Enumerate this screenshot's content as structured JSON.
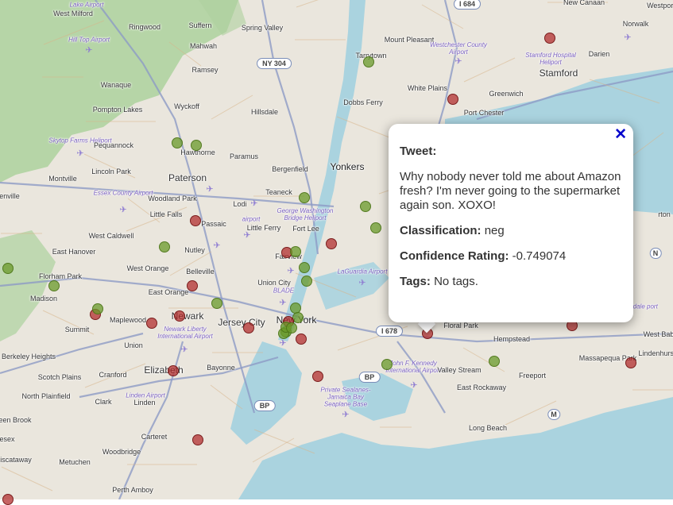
{
  "map": {
    "labels": {
      "west_milford": "West Milford",
      "greenwood_lake_airport": "Lake Airport",
      "ringwood": "Ringwood",
      "suffern": "Suffern",
      "spring_valley": "Spring Valley",
      "new_canaan": "New Canaan",
      "westport": "Westport",
      "hill_top_airport": "Hill Top Airport",
      "mahwah": "Mahwah",
      "mount_pleasant": "Mount Pleasant",
      "westchester_airport": "Westchester County Airport",
      "norwalk": "Norwalk",
      "darien": "Darien",
      "ramsey": "Ramsey",
      "tarrytown": "Tarrytown",
      "stamford_hospital": "Stamford Hospital Heliport",
      "stamford": "Stamford",
      "wanaque": "Wanaque",
      "white_plains": "White Plains",
      "greenwich": "Greenwich",
      "pompton_lakes": "Pompton Lakes",
      "wyckoff": "Wyckoff",
      "hillsdale": "Hillsdale",
      "dobbs_ferry": "Dobbs Ferry",
      "port_chester": "Port Chester",
      "skytop_heliport": "Skytop Farms Heliport",
      "pequannock": "Pequannock",
      "hawthorne": "Hawthorne",
      "paramus": "Paramus",
      "paterson": "Paterson",
      "montville": "Montville",
      "lincoln_park": "Lincoln Park",
      "bergenfield": "Bergenfield",
      "yonkers": "Yonkers",
      "essex_airport": "Essex County Airport",
      "woodland_park": "Woodland Park",
      "teaneck": "Teaneck",
      "genville": "enville",
      "little_falls": "Little Falls",
      "lodi": "Lodi",
      "gw_bridge_heliport": "George Washington Bridge Heliport",
      "airport_teterboro": "airport",
      "passaic": "Passaic",
      "little_ferry": "Little Ferry",
      "fort_lee": "Fort Lee",
      "west_caldwell": "West Caldwell",
      "east_hanover": "East Hanover",
      "nutley": "Nutley",
      "fairview": "Fairview",
      "west_orange": "West Orange",
      "belleville": "Belleville",
      "florham_park": "Florham Park",
      "union_city": "Union City",
      "laguardia": "LaGuardia Airport",
      "east_orange": "East Orange",
      "blade": "BLADE",
      "madison": "Madison",
      "newark": "Newark",
      "maplewood": "Maplewood",
      "jersey_city": "Jersey City",
      "new_york": "New York",
      "newark_airport": "Newark Liberty International Airport",
      "summit": "Summit",
      "floral_park": "Floral Park",
      "west_bab": "West Bab",
      "union": "Union",
      "hempstead": "Hempstead",
      "berkeley_heights": "Berkeley Heights",
      "massapequa_park": "Massapequa Park",
      "lindenhurst": "Lindenhurst",
      "elizabeth": "Elizabeth",
      "bayonne": "Bayonne",
      "jfk": "John F. Kennedy International Airport",
      "valley_stream": "Valley Stream",
      "scotch_plains": "Scotch Plains",
      "cranford": "Cranford",
      "freeport": "Freeport",
      "east_rockaway": "East Rockaway",
      "north_plainfield": "North Plainfield",
      "linden_airport": "Linden Airport",
      "clark": "Clark",
      "linden": "Linden",
      "jamaica_seaplane": "Private Sealanes-Jamaica Bay Seaplane Base",
      "green_brook": "een Brook",
      "long_beach": "Long Beach",
      "carteret": "Carteret",
      "sex": "esex",
      "woodbridge": "Woodbridge",
      "piscataway": "iscataway",
      "metuchen": "Metuchen",
      "perth_amboy": "Perth Amboy",
      "hurst_partial": "rton",
      "beach_airport": "gdale port"
    },
    "shields": {
      "i684": "I 684",
      "ny304": "NY 304",
      "i678": "I 678",
      "bp1": "BP",
      "bp2": "BP",
      "n_route": "N",
      "m_route": "M"
    },
    "markers": [
      {
        "sentiment": "neg"
      },
      {
        "sentiment": "pos"
      },
      {
        "sentiment": "neg"
      },
      {
        "sentiment": "pos"
      },
      {
        "sentiment": "pos"
      },
      {
        "sentiment": "pos"
      },
      {
        "sentiment": "neg"
      },
      {
        "sentiment": "pos"
      },
      {
        "sentiment": "pos"
      },
      {
        "sentiment": "pos"
      },
      {
        "sentiment": "neg"
      },
      {
        "sentiment": "neg"
      },
      {
        "sentiment": "pos"
      },
      {
        "sentiment": "pos"
      },
      {
        "sentiment": "pos"
      },
      {
        "sentiment": "neg"
      },
      {
        "sentiment": "neg"
      },
      {
        "sentiment": "neg"
      },
      {
        "sentiment": "pos"
      },
      {
        "sentiment": "pos"
      },
      {
        "sentiment": "neg"
      },
      {
        "sentiment": "pos"
      },
      {
        "sentiment": "pos"
      },
      {
        "sentiment": "neg"
      },
      {
        "sentiment": "pos"
      },
      {
        "sentiment": "pos"
      },
      {
        "sentiment": "neg"
      },
      {
        "sentiment": "neg"
      },
      {
        "sentiment": "neg"
      },
      {
        "sentiment": "neg"
      },
      {
        "sentiment": "pos"
      },
      {
        "sentiment": "pos"
      },
      {
        "sentiment": "neg"
      },
      {
        "sentiment": "pos"
      },
      {
        "sentiment": "neg"
      },
      {
        "sentiment": "neg"
      },
      {
        "sentiment": "pos"
      },
      {
        "sentiment": "neg"
      },
      {
        "sentiment": "neg"
      },
      {
        "sentiment": "pos"
      },
      {
        "sentiment": "pos"
      }
    ]
  },
  "popup": {
    "close_label": "✕",
    "tweet_heading": "Tweet:",
    "tweet_text": "Why nobody never told me about Amazon fresh? I'm never going to the supermarket again son. XOXO!",
    "classification_heading": "Classification:",
    "classification_value": "neg",
    "confidence_heading": "Confidence Rating:",
    "confidence_value": "-0.749074",
    "tags_heading": "Tags:",
    "tags_value": "No tags."
  },
  "colors": {
    "water": "#aad3df",
    "land": "#eae6dd",
    "forest": "#add19e",
    "highway": "#8d9bc6",
    "marker_positive": "#6a9a29",
    "marker_negative": "#b02828",
    "close_x": "#0000cc"
  }
}
